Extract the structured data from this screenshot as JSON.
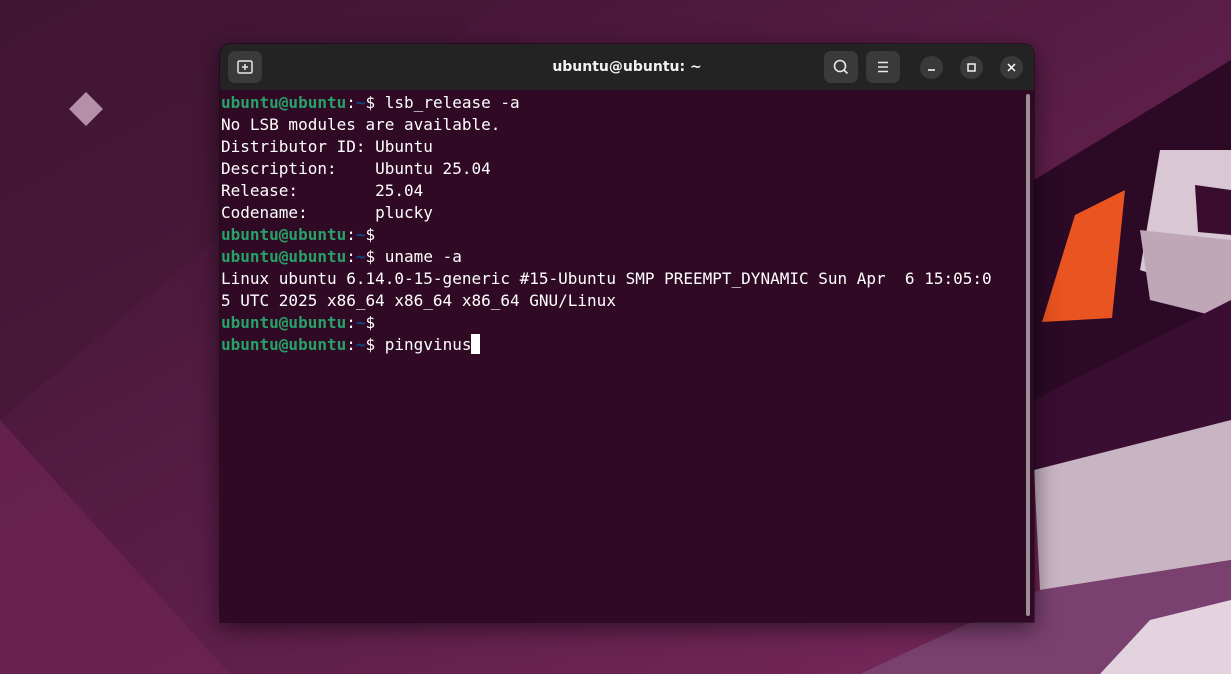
{
  "window": {
    "title": "ubuntu@ubuntu: ~"
  },
  "terminal": {
    "lines": [
      {
        "kind": "prompt",
        "user": "ubuntu@ubuntu",
        "colon": ":",
        "path": "~",
        "dollar": "$ ",
        "command": "lsb_release -a"
      },
      {
        "kind": "output",
        "text": "No LSB modules are available."
      },
      {
        "kind": "output",
        "text": "Distributor ID:\tUbuntu"
      },
      {
        "kind": "output",
        "text": "Description:\tUbuntu 25.04"
      },
      {
        "kind": "output",
        "text": "Release:\t25.04"
      },
      {
        "kind": "output",
        "text": "Codename:\tplucky"
      },
      {
        "kind": "prompt",
        "user": "ubuntu@ubuntu",
        "colon": ":",
        "path": "~",
        "dollar": "$",
        "command": ""
      },
      {
        "kind": "prompt",
        "user": "ubuntu@ubuntu",
        "colon": ":",
        "path": "~",
        "dollar": "$ ",
        "command": "uname -a"
      },
      {
        "kind": "output",
        "text": "Linux ubuntu 6.14.0-15-generic #15-Ubuntu SMP PREEMPT_DYNAMIC Sun Apr  6 15:05:0"
      },
      {
        "kind": "output",
        "text": "5 UTC 2025 x86_64 x86_64 x86_64 GNU/Linux"
      },
      {
        "kind": "prompt",
        "user": "ubuntu@ubuntu",
        "colon": ":",
        "path": "~",
        "dollar": "$",
        "command": ""
      },
      {
        "kind": "prompt",
        "user": "ubuntu@ubuntu",
        "colon": ":",
        "path": "~",
        "dollar": "$ ",
        "command": "pingvinus",
        "cursor": true
      }
    ]
  },
  "icons": {
    "new_tab": "new-tab-icon",
    "search": "search-icon",
    "menu": "hamburger-menu-icon",
    "minimize": "minimize-icon",
    "maximize": "maximize-icon",
    "close": "close-icon",
    "desktop": "desktop-diamond-icon"
  },
  "colors": {
    "terminal_bg": "#300a24",
    "titlebar_bg": "#232323",
    "prompt_user": "#26a269",
    "prompt_path": "#12488b",
    "accent_orange": "#e95420"
  }
}
